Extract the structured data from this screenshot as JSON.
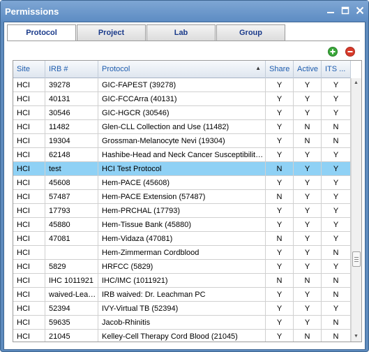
{
  "window": {
    "title": "Permissions"
  },
  "tabs": [
    "Protocol",
    "Project",
    "Lab",
    "Group"
  ],
  "grid": {
    "columns": [
      "Site",
      "IRB #",
      "Protocol",
      "Share",
      "Active",
      "ITS ..."
    ],
    "sort_column": "Protocol",
    "rows": [
      [
        "HCI",
        "39278",
        "GIC-FAPEST (39278)",
        "Y",
        "Y",
        "Y"
      ],
      [
        "HCI",
        "40131",
        "GIC-FCCArra (40131)",
        "Y",
        "Y",
        "Y"
      ],
      [
        "HCI",
        "30546",
        "GIC-HGCR (30546)",
        "Y",
        "Y",
        "Y"
      ],
      [
        "HCI",
        "11482",
        "Glen-CLL Collection and Use (11482)",
        "Y",
        "N",
        "N"
      ],
      [
        "HCI",
        "19304",
        "Grossman-Melanocyte Nevi (19304)",
        "Y",
        "N",
        "N"
      ],
      [
        "HCI",
        "62148",
        "Hashibe-Head and Neck Cancer Susceptibility ...",
        "Y",
        "Y",
        "Y"
      ],
      [
        "HCI",
        "test",
        "HCI Test Protocol",
        "N",
        "Y",
        "Y"
      ],
      [
        "HCI",
        "45608",
        "Hem-PACE (45608)",
        "Y",
        "Y",
        "Y"
      ],
      [
        "HCI",
        "57487",
        "Hem-PACE Extension (57487)",
        "N",
        "Y",
        "Y"
      ],
      [
        "HCI",
        "17793",
        "Hem-PRCHAL (17793)",
        "Y",
        "Y",
        "Y"
      ],
      [
        "HCI",
        "45880",
        "Hem-Tissue Bank (45880)",
        "Y",
        "Y",
        "Y"
      ],
      [
        "HCI",
        "47081",
        "Hem-Vidaza (47081)",
        "N",
        "Y",
        "Y"
      ],
      [
        "HCI",
        "",
        "Hem-Zimmerman Cordblood",
        "Y",
        "Y",
        "N"
      ],
      [
        "HCI",
        "5829",
        "HRFCC (5829)",
        "Y",
        "Y",
        "Y"
      ],
      [
        "HCI",
        "IHC 1011921",
        "IHC/IMC (1011921)",
        "N",
        "N",
        "N"
      ],
      [
        "HCI",
        "waived-Leac...",
        "IRB waived: Dr. Leachman PC",
        "Y",
        "Y",
        "N"
      ],
      [
        "HCI",
        "52394",
        "IVY-Virtual TB (52394)",
        "Y",
        "Y",
        "Y"
      ],
      [
        "HCI",
        "59635",
        "Jacob-Rhinitis",
        "Y",
        "Y",
        "N"
      ],
      [
        "HCI",
        "21045",
        "Kelley-Cell Therapy Cord Blood (21045)",
        "Y",
        "N",
        "N"
      ]
    ],
    "selected_row": 6
  },
  "colors": {
    "title_bar": "#5d8cc3",
    "selection": "#8fd1f5",
    "header_text": "#1d5cae",
    "add": "#3aa83a",
    "remove": "#d83a2a"
  },
  "icons": {
    "add": "add-icon",
    "remove": "remove-icon",
    "minimize": "minimize-icon",
    "maximize": "maximize-icon",
    "close": "close-icon"
  }
}
